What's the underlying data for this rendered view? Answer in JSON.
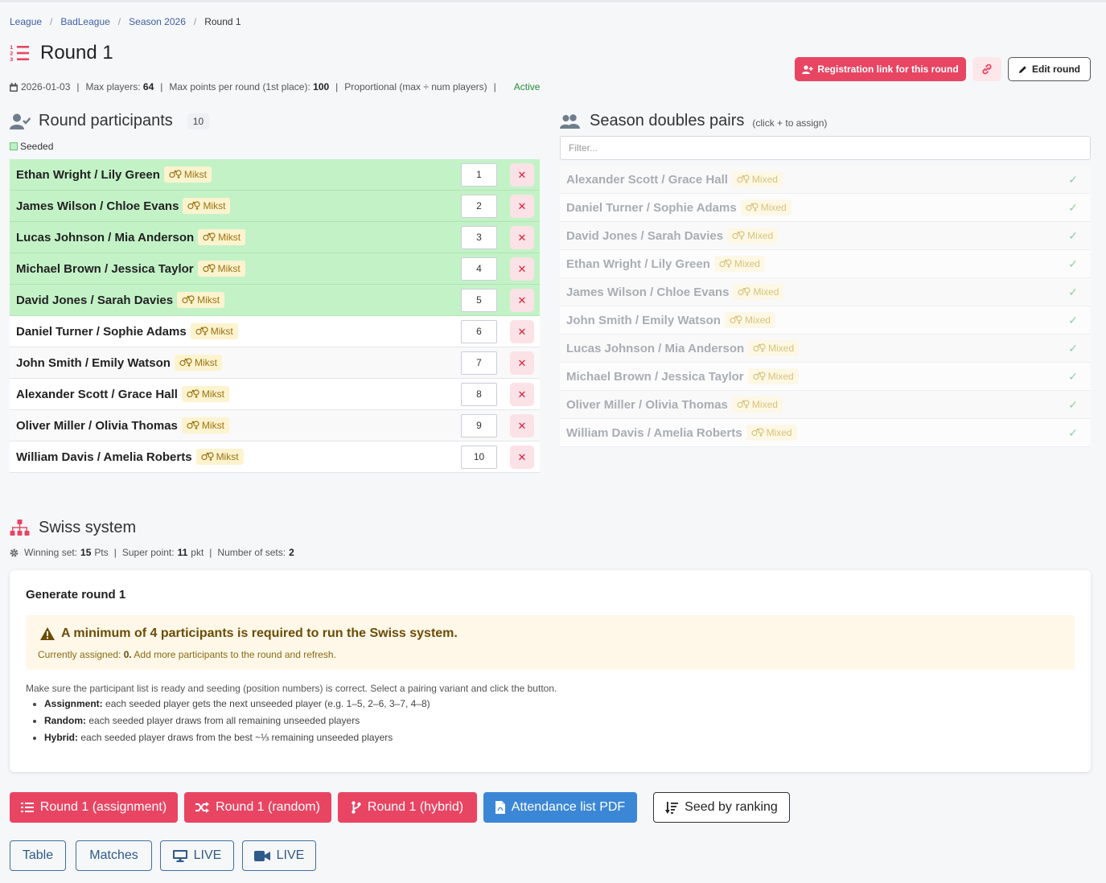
{
  "breadcrumb": {
    "items": [
      "League",
      "BadLeague",
      "Season 2026"
    ],
    "current": "Round 1"
  },
  "page": {
    "title": "Round 1"
  },
  "meta": {
    "date": "2026-01-03",
    "max_players_label": "Max players:",
    "max_players": "64",
    "max_points_label": "Max points per round (1st place):",
    "max_points": "100",
    "mode": "Proportional (max ÷ num players)",
    "status": "Active"
  },
  "actions": {
    "registration_label": "Registration link for this round",
    "edit_label": "Edit round"
  },
  "participants": {
    "title": "Round participants",
    "count": "10",
    "seeded_legend": "Seeded",
    "rows": [
      {
        "name": "Ethan Wright / Lily Green",
        "badge": "Mikst",
        "seed": "1",
        "seeded": true
      },
      {
        "name": "James Wilson / Chloe Evans",
        "badge": "Mikst",
        "seed": "2",
        "seeded": true
      },
      {
        "name": "Lucas Johnson / Mia Anderson",
        "badge": "Mikst",
        "seed": "3",
        "seeded": true
      },
      {
        "name": "Michael Brown / Jessica Taylor",
        "badge": "Mikst",
        "seed": "4",
        "seeded": true
      },
      {
        "name": "David Jones / Sarah Davies",
        "badge": "Mikst",
        "seed": "5",
        "seeded": true
      },
      {
        "name": "Daniel Turner / Sophie Adams",
        "badge": "Mikst",
        "seed": "6",
        "seeded": false
      },
      {
        "name": "John Smith / Emily Watson",
        "badge": "Mikst",
        "seed": "7",
        "seeded": false
      },
      {
        "name": "Alexander Scott / Grace Hall",
        "badge": "Mikst",
        "seed": "8",
        "seeded": false
      },
      {
        "name": "Oliver Miller / Olivia Thomas",
        "badge": "Mikst",
        "seed": "9",
        "seeded": false
      },
      {
        "name": "William Davis / Amelia Roberts",
        "badge": "Mikst",
        "seed": "10",
        "seeded": false
      }
    ]
  },
  "pairs": {
    "title": "Season doubles pairs",
    "hint": "(click + to assign)",
    "filter_placeholder": "Filter...",
    "rows": [
      {
        "name": "Alexander Scott / Grace Hall",
        "badge": "Mixed"
      },
      {
        "name": "Daniel Turner / Sophie Adams",
        "badge": "Mixed"
      },
      {
        "name": "David Jones / Sarah Davies",
        "badge": "Mixed"
      },
      {
        "name": "Ethan Wright / Lily Green",
        "badge": "Mixed"
      },
      {
        "name": "James Wilson / Chloe Evans",
        "badge": "Mixed"
      },
      {
        "name": "John Smith / Emily Watson",
        "badge": "Mixed"
      },
      {
        "name": "Lucas Johnson / Mia Anderson",
        "badge": "Mixed"
      },
      {
        "name": "Michael Brown / Jessica Taylor",
        "badge": "Mixed"
      },
      {
        "name": "Oliver Miller / Olivia Thomas",
        "badge": "Mixed"
      },
      {
        "name": "William Davis / Amelia Roberts",
        "badge": "Mixed"
      }
    ]
  },
  "swiss": {
    "title": "Swiss system",
    "winning_set_label": "Winning set:",
    "winning_set": "15",
    "winning_set_unit": "Pts",
    "super_point_label": "Super point:",
    "super_point": "11",
    "super_point_unit": "pkt",
    "sets_label": "Number of sets:",
    "sets": "2",
    "card_title": "Generate round 1",
    "warning_title": "A minimum of 4 participants is required to run the Swiss system.",
    "warning_sub_prefix": "Currently assigned:",
    "warning_sub_value": "0.",
    "warning_sub_suffix": "Add more participants to the round and refresh.",
    "description": "Make sure the participant list is ready and seeding (position numbers) is correct. Select a pairing variant and click the button.",
    "bullets": [
      {
        "term": "Assignment:",
        "text": "each seeded player gets the next unseeded player (e.g. 1–5, 2–6, 3–7, 4–8)"
      },
      {
        "term": "Random:",
        "text": "each seeded player draws from all remaining unseeded players"
      },
      {
        "term": "Hybrid:",
        "text": "each seeded player draws from the best ~⅓ remaining unseeded players"
      }
    ]
  },
  "buttons": {
    "assignment": "Round 1 (assignment)",
    "random": "Round 1 (random)",
    "hybrid": "Round 1 (hybrid)",
    "attendance": "Attendance list PDF",
    "seed_ranking": "Seed by ranking",
    "table": "Table",
    "matches": "Matches",
    "live1": "LIVE",
    "live2": "LIVE"
  },
  "colors": {
    "primary": "#e84563",
    "seeded": "#c3f2c7",
    "info": "#3b87d6",
    "outline": "#3f6fa0"
  }
}
